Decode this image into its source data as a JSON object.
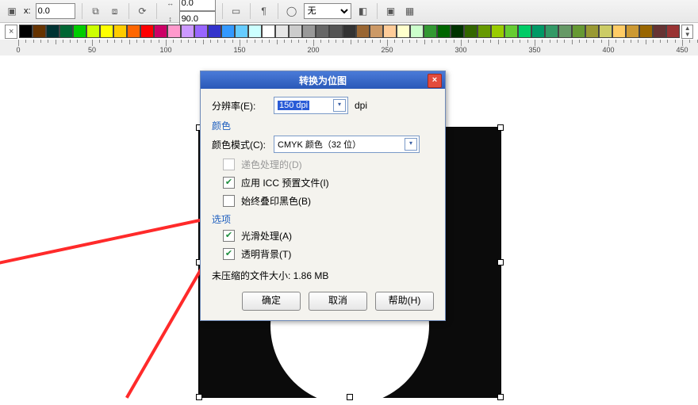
{
  "toolbar": {
    "x_value": "0.0",
    "deg_value_1": "0.0",
    "deg_value_2": "90.0",
    "outline_label": "无"
  },
  "ruler": {
    "ticks": [
      0,
      50,
      100,
      150,
      200,
      250,
      300,
      350,
      400,
      450
    ]
  },
  "dialog": {
    "title": "转换为位图",
    "resolution_label": "分辨率(E):",
    "resolution_value": "150 dpi",
    "dpi_suffix": "dpi",
    "color_section": "颜色",
    "color_mode_label": "颜色模式(C):",
    "color_mode_value": "CMYK 颜色（32 位）",
    "dithered_label": "递色处理的(D)",
    "use_icc_label": "应用 ICC 预置文件(I)",
    "overprint_label": "始终叠印黑色(B)",
    "options_section": "选项",
    "antialias_label": "光滑处理(A)",
    "transparent_label": "透明背景(T)",
    "size_label": "未压缩的文件大小: 1.86 MB",
    "ok": "确定",
    "cancel": "取消",
    "help": "帮助(H)"
  }
}
